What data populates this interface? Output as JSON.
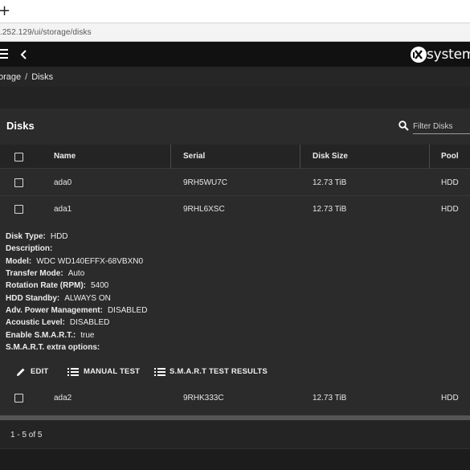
{
  "browser": {
    "new_tab_glyph": "+",
    "url": ".252.129/ui/storage/disks"
  },
  "topbar": {
    "menu_icon": "hamburger-icon",
    "back_icon": "chevron-left-icon",
    "brand_text": "systems"
  },
  "breadcrumb": {
    "parent": "orage",
    "separator": "/",
    "current": "Disks"
  },
  "card": {
    "title": "Disks",
    "filter_placeholder": "Filter Disks"
  },
  "table": {
    "columns": [
      "Name",
      "Serial",
      "Disk Size",
      "Pool"
    ],
    "rows": [
      {
        "name": "ada0",
        "serial": "9RH5WU7C",
        "size": "12.73 TiB",
        "pool": "HDD"
      },
      {
        "name": "ada1",
        "serial": "9RHL6XSC",
        "size": "12.73 TiB",
        "pool": "HDD"
      },
      {
        "name": "ada2",
        "serial": "9RHK333C",
        "size": "12.73 TiB",
        "pool": "HDD"
      }
    ]
  },
  "details": [
    {
      "key": "Disk Type:",
      "value": "HDD"
    },
    {
      "key": "Description:",
      "value": ""
    },
    {
      "key": "Model:",
      "value": "WDC WD140EFFX-68VBXN0"
    },
    {
      "key": "Transfer Mode:",
      "value": "Auto"
    },
    {
      "key": "Rotation Rate (RPM):",
      "value": "5400"
    },
    {
      "key": "HDD Standby:",
      "value": "ALWAYS ON"
    },
    {
      "key": "Adv. Power Management:",
      "value": "DISABLED"
    },
    {
      "key": "Acoustic Level:",
      "value": "DISABLED"
    },
    {
      "key": "Enable S.M.A.R.T.:",
      "value": "true"
    },
    {
      "key": "S.M.A.R.T. extra options:",
      "value": ""
    }
  ],
  "actions": {
    "edit": "EDIT",
    "manual_test": "MANUAL TEST",
    "smart_results": "S.M.A.R.T TEST RESULTS"
  },
  "footer": {
    "range": "1 - 5 of 5"
  },
  "colors": {
    "topbar": "#111111",
    "card": "#2b2b2b",
    "header": "#242424"
  }
}
